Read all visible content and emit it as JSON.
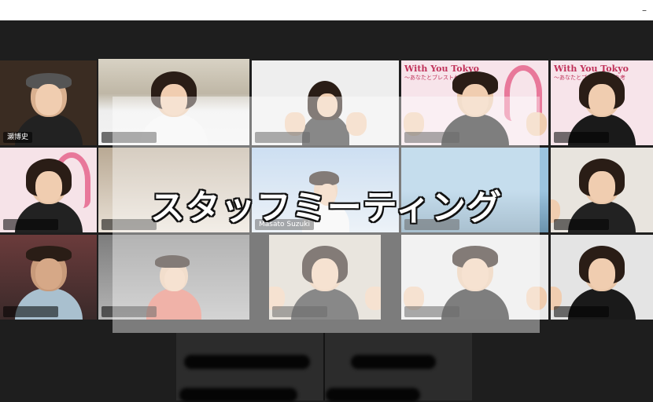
{
  "window": {
    "minimize_glyph": "–"
  },
  "participants": [
    {
      "name": "瀬博史",
      "tile_bg": "#3a2c22",
      "banner": false
    },
    {
      "name": "",
      "tile_bg": "#c9c3b8",
      "banner": false,
      "active": true
    },
    {
      "name": "",
      "tile_bg": "#efefef",
      "banner": false
    },
    {
      "name": "",
      "tile_bg": "#f6e3e8",
      "banner": true
    },
    {
      "name": "",
      "tile_bg": "#f6e3e8",
      "banner": true
    },
    {
      "name": "",
      "tile_bg": "#f6e3e8",
      "banner": false
    },
    {
      "name": "",
      "tile_bg": "#b9a994",
      "banner": false
    },
    {
      "name": "Masato Suzuki",
      "tile_bg": "#a9c8e8",
      "banner": false
    },
    {
      "name": "",
      "tile_bg": "#8fb6cf",
      "banner": false
    },
    {
      "name": "",
      "tile_bg": "#e8e4de",
      "banner": false
    },
    {
      "name": "",
      "tile_bg": "#6b3b3b",
      "banner": false
    },
    {
      "name": "",
      "tile_bg": "#8e8e8e",
      "banner": false
    },
    {
      "name": "",
      "tile_bg": "#d9d2c6",
      "banner": false
    },
    {
      "name": "",
      "tile_bg": "#e4e4e4",
      "banner": false
    },
    {
      "name": "",
      "tile_bg": "#cfcfcf",
      "banner": false
    }
  ],
  "banner": {
    "title": "With You Tokyo",
    "subtitle": "～あなたとブレストケアを考"
  },
  "overlay_title": "スタッフミーティング"
}
